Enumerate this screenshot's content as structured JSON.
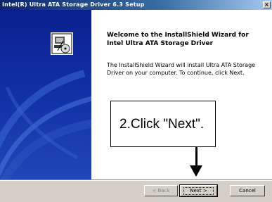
{
  "window": {
    "title": "Intel(R) Ultra ATA Storage Driver 6.3 Setup",
    "close_glyph": "×"
  },
  "wizard": {
    "heading": "Welcome to the InstallShield Wizard for Intel Ultra ATA Storage Driver",
    "body": "The InstallShield Wizard will install Ultra ATA Storage Driver on your computer. To continue, click Next."
  },
  "callout": {
    "text": "2.Click \"Next\"."
  },
  "buttons": {
    "back": "< Back",
    "next": "Next >",
    "cancel": "Cancel"
  },
  "colors": {
    "titlebar_start": "#0a246a",
    "left_panel": "#1233a8",
    "dialog_face": "#d4d0c8"
  },
  "icons": {
    "setup": "computer-disk-setup-icon",
    "close": "close-icon",
    "arrow": "down-arrow-annotation"
  }
}
